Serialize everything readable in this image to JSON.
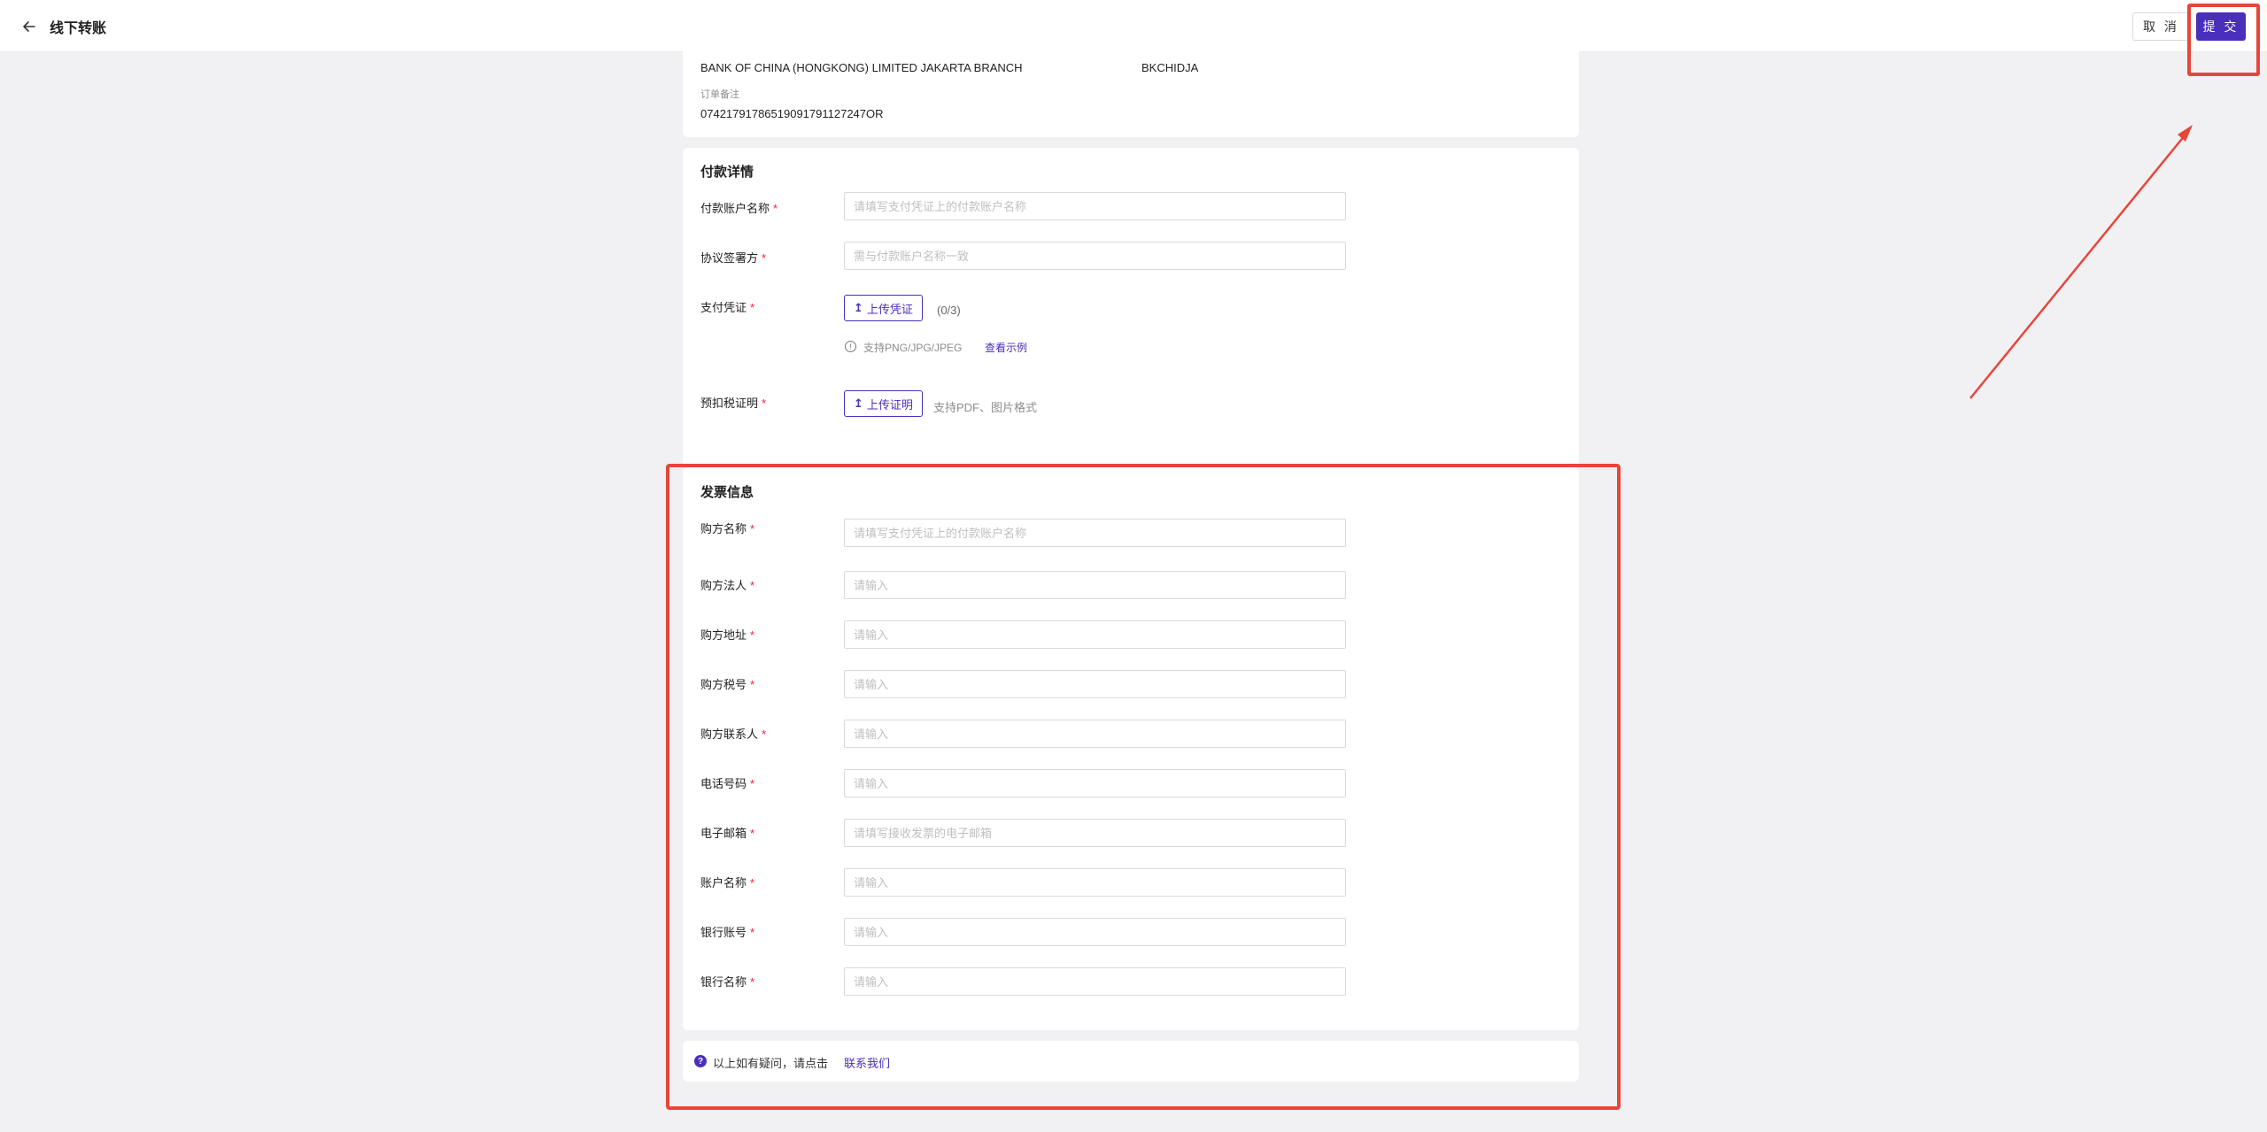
{
  "header": {
    "title": "线下转账",
    "cancel_label": "取 消",
    "submit_label": "提 交"
  },
  "bank": {
    "name": "BANK OF CHINA (HONGKONG) LIMITED JAKARTA BRANCH",
    "code": "BKCHIDJA",
    "memo_label": "订单备注",
    "memo_value": "0742179178651909179112​7247OR"
  },
  "payment": {
    "title": "付款详情",
    "payer_account_label": "付款账户名称",
    "payer_account_placeholder": "请填写支付凭证上的付款账户名称",
    "signatory_label": "协议签署方",
    "signatory_placeholder": "需与付款账户名称一致",
    "voucher_label": "支付凭证",
    "voucher_button": "上传凭证",
    "voucher_count": "(0/3)",
    "voucher_hint": "支持PNG/JPG/JPEG",
    "voucher_example": "查看示例",
    "tax_label": "预扣税证明",
    "tax_button": "上传证明",
    "tax_hint": "支持PDF、图片格式"
  },
  "invoice": {
    "title": "发票信息",
    "fields": [
      {
        "label": "购方名称",
        "placeholder": "请填写支付凭证上的付款账户名称"
      },
      {
        "label": "购方法人",
        "placeholder": "请输入"
      },
      {
        "label": "购方地址",
        "placeholder": "请输入"
      },
      {
        "label": "购方税号",
        "placeholder": "请输入"
      },
      {
        "label": "购方联系人",
        "placeholder": "请输入"
      },
      {
        "label": "电话号码",
        "placeholder": "请输入"
      },
      {
        "label": "电子邮箱",
        "placeholder": "请填写接收发票的电子邮箱"
      },
      {
        "label": "账户名称",
        "placeholder": "请输入"
      },
      {
        "label": "银行账号",
        "placeholder": "请输入"
      },
      {
        "label": "银行名称",
        "placeholder": "请输入"
      }
    ]
  },
  "footer": {
    "help_text": "以上如有疑问，请点击",
    "contact_link": "联系我们"
  },
  "icons": {
    "back": "arrow-left-icon",
    "upload": "upload-icon",
    "info": "info-icon",
    "help": "question-icon"
  },
  "colors": {
    "primary": "#4a2fbd",
    "required": "#f5222d",
    "annotation": "#e8453a",
    "background": "#f1f1f3"
  }
}
